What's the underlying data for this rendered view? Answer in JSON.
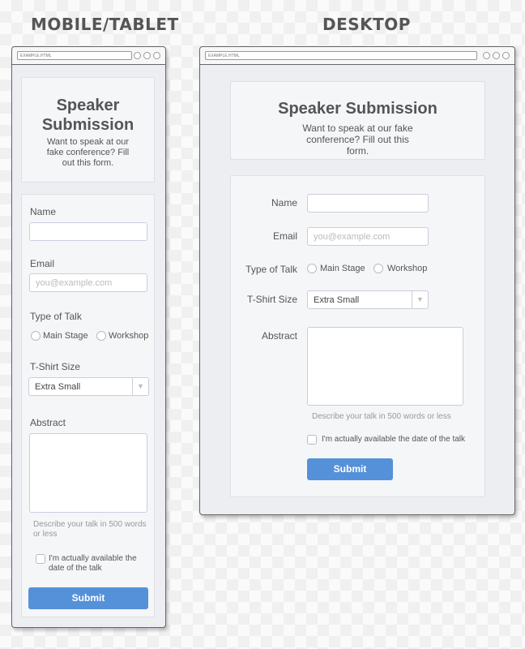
{
  "headings": {
    "mobile": "MOBILE/TABLET",
    "desktop": "DESKTOP"
  },
  "browser": {
    "url": "EXAMPLE.HTML"
  },
  "form": {
    "title": "Speaker Submission",
    "subtitle": "Want to speak at our fake conference? Fill out this form.",
    "name_label": "Name",
    "name_value": "",
    "email_label": "Email",
    "email_placeholder": "you@example.com",
    "talk_label": "Type of Talk",
    "talk_options": [
      "Main Stage",
      "Workshop"
    ],
    "shirt_label": "T-Shirt Size",
    "shirt_value": "Extra Small",
    "abstract_label": "Abstract",
    "abstract_hint": "Describe your talk in 500 words or less",
    "available_label": "I'm actually available the date of the talk",
    "submit": "Submit"
  },
  "colors": {
    "accent": "#5591d9"
  }
}
